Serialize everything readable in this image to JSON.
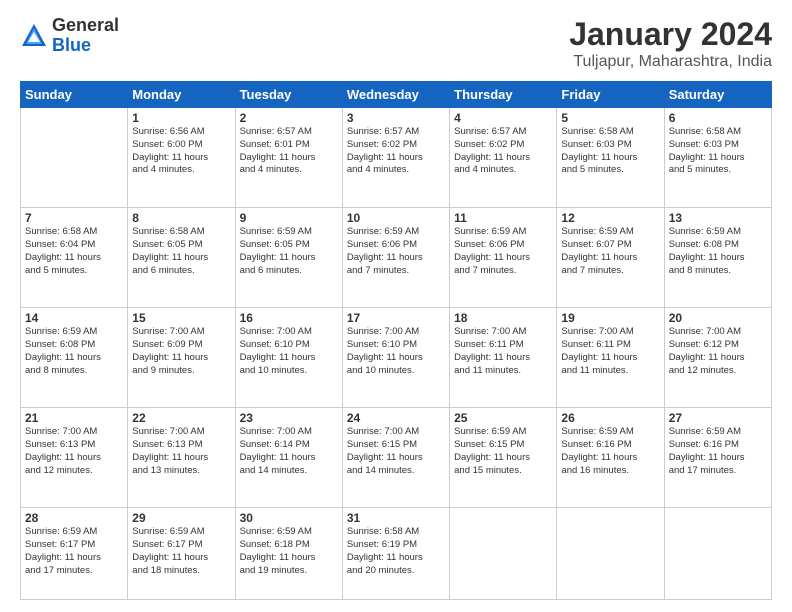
{
  "logo": {
    "general": "General",
    "blue": "Blue"
  },
  "title": "January 2024",
  "subtitle": "Tuljapur, Maharashtra, India",
  "weekdays": [
    "Sunday",
    "Monday",
    "Tuesday",
    "Wednesday",
    "Thursday",
    "Friday",
    "Saturday"
  ],
  "weeks": [
    [
      {
        "day": "",
        "info": ""
      },
      {
        "day": "1",
        "info": "Sunrise: 6:56 AM\nSunset: 6:00 PM\nDaylight: 11 hours\nand 4 minutes."
      },
      {
        "day": "2",
        "info": "Sunrise: 6:57 AM\nSunset: 6:01 PM\nDaylight: 11 hours\nand 4 minutes."
      },
      {
        "day": "3",
        "info": "Sunrise: 6:57 AM\nSunset: 6:02 PM\nDaylight: 11 hours\nand 4 minutes."
      },
      {
        "day": "4",
        "info": "Sunrise: 6:57 AM\nSunset: 6:02 PM\nDaylight: 11 hours\nand 4 minutes."
      },
      {
        "day": "5",
        "info": "Sunrise: 6:58 AM\nSunset: 6:03 PM\nDaylight: 11 hours\nand 5 minutes."
      },
      {
        "day": "6",
        "info": "Sunrise: 6:58 AM\nSunset: 6:03 PM\nDaylight: 11 hours\nand 5 minutes."
      }
    ],
    [
      {
        "day": "7",
        "info": "Sunrise: 6:58 AM\nSunset: 6:04 PM\nDaylight: 11 hours\nand 5 minutes."
      },
      {
        "day": "8",
        "info": "Sunrise: 6:58 AM\nSunset: 6:05 PM\nDaylight: 11 hours\nand 6 minutes."
      },
      {
        "day": "9",
        "info": "Sunrise: 6:59 AM\nSunset: 6:05 PM\nDaylight: 11 hours\nand 6 minutes."
      },
      {
        "day": "10",
        "info": "Sunrise: 6:59 AM\nSunset: 6:06 PM\nDaylight: 11 hours\nand 7 minutes."
      },
      {
        "day": "11",
        "info": "Sunrise: 6:59 AM\nSunset: 6:06 PM\nDaylight: 11 hours\nand 7 minutes."
      },
      {
        "day": "12",
        "info": "Sunrise: 6:59 AM\nSunset: 6:07 PM\nDaylight: 11 hours\nand 7 minutes."
      },
      {
        "day": "13",
        "info": "Sunrise: 6:59 AM\nSunset: 6:08 PM\nDaylight: 11 hours\nand 8 minutes."
      }
    ],
    [
      {
        "day": "14",
        "info": "Sunrise: 6:59 AM\nSunset: 6:08 PM\nDaylight: 11 hours\nand 8 minutes."
      },
      {
        "day": "15",
        "info": "Sunrise: 7:00 AM\nSunset: 6:09 PM\nDaylight: 11 hours\nand 9 minutes."
      },
      {
        "day": "16",
        "info": "Sunrise: 7:00 AM\nSunset: 6:10 PM\nDaylight: 11 hours\nand 10 minutes."
      },
      {
        "day": "17",
        "info": "Sunrise: 7:00 AM\nSunset: 6:10 PM\nDaylight: 11 hours\nand 10 minutes."
      },
      {
        "day": "18",
        "info": "Sunrise: 7:00 AM\nSunset: 6:11 PM\nDaylight: 11 hours\nand 11 minutes."
      },
      {
        "day": "19",
        "info": "Sunrise: 7:00 AM\nSunset: 6:11 PM\nDaylight: 11 hours\nand 11 minutes."
      },
      {
        "day": "20",
        "info": "Sunrise: 7:00 AM\nSunset: 6:12 PM\nDaylight: 11 hours\nand 12 minutes."
      }
    ],
    [
      {
        "day": "21",
        "info": "Sunrise: 7:00 AM\nSunset: 6:13 PM\nDaylight: 11 hours\nand 12 minutes."
      },
      {
        "day": "22",
        "info": "Sunrise: 7:00 AM\nSunset: 6:13 PM\nDaylight: 11 hours\nand 13 minutes."
      },
      {
        "day": "23",
        "info": "Sunrise: 7:00 AM\nSunset: 6:14 PM\nDaylight: 11 hours\nand 14 minutes."
      },
      {
        "day": "24",
        "info": "Sunrise: 7:00 AM\nSunset: 6:15 PM\nDaylight: 11 hours\nand 14 minutes."
      },
      {
        "day": "25",
        "info": "Sunrise: 6:59 AM\nSunset: 6:15 PM\nDaylight: 11 hours\nand 15 minutes."
      },
      {
        "day": "26",
        "info": "Sunrise: 6:59 AM\nSunset: 6:16 PM\nDaylight: 11 hours\nand 16 minutes."
      },
      {
        "day": "27",
        "info": "Sunrise: 6:59 AM\nSunset: 6:16 PM\nDaylight: 11 hours\nand 17 minutes."
      }
    ],
    [
      {
        "day": "28",
        "info": "Sunrise: 6:59 AM\nSunset: 6:17 PM\nDaylight: 11 hours\nand 17 minutes."
      },
      {
        "day": "29",
        "info": "Sunrise: 6:59 AM\nSunset: 6:17 PM\nDaylight: 11 hours\nand 18 minutes."
      },
      {
        "day": "30",
        "info": "Sunrise: 6:59 AM\nSunset: 6:18 PM\nDaylight: 11 hours\nand 19 minutes."
      },
      {
        "day": "31",
        "info": "Sunrise: 6:58 AM\nSunset: 6:19 PM\nDaylight: 11 hours\nand 20 minutes."
      },
      {
        "day": "",
        "info": ""
      },
      {
        "day": "",
        "info": ""
      },
      {
        "day": "",
        "info": ""
      }
    ]
  ]
}
